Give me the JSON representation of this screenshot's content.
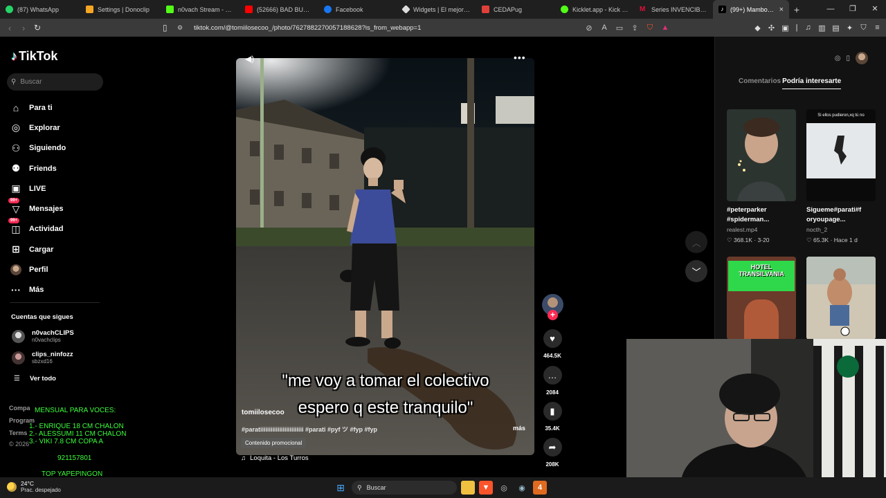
{
  "browser": {
    "tabs": [
      {
        "title": "(87) WhatsApp",
        "color": "#25d366"
      },
      {
        "title": "Settings | Donoclip",
        "color": "#f5a623"
      },
      {
        "title": "n0vach Stream - Watch",
        "color": "#53fc18"
      },
      {
        "title": "(52666) BAD BUNNY -",
        "color": "#ff0000"
      },
      {
        "title": "Facebook",
        "color": "#1877f2"
      },
      {
        "title": "Widgets | El mejor soft",
        "color": "#dddddd"
      },
      {
        "title": "CEDAPug",
        "color": "#e0403a"
      },
      {
        "title": "Kicklet.app - Kick Chat",
        "color": "#53fc18"
      },
      {
        "title": "Series INVENCIBLE (20",
        "color": "#e0103a"
      },
      {
        "title": "(99+) Mambo Mul",
        "color": "#222222",
        "active": true
      }
    ],
    "url": "tiktok.com/@tomiilosecoo_/photo/7627882270057188628?is_from_webapp=1"
  },
  "tiktok": {
    "logo": "TikTok",
    "search_placeholder": "Buscar",
    "nav": [
      {
        "label": "Para ti",
        "icon": "home-icon"
      },
      {
        "label": "Explorar",
        "icon": "compass-icon"
      },
      {
        "label": "Siguiendo",
        "icon": "following-icon"
      },
      {
        "label": "Friends",
        "icon": "friends-icon"
      },
      {
        "label": "LIVE",
        "icon": "live-icon"
      },
      {
        "label": "Mensajes",
        "icon": "messages-icon",
        "badge": "99+"
      },
      {
        "label": "Actividad",
        "icon": "activity-icon",
        "badge": "99+"
      },
      {
        "label": "Cargar",
        "icon": "upload-icon"
      },
      {
        "label": "Perfil",
        "icon": "avatar"
      },
      {
        "label": "Más",
        "icon": "more-icon"
      }
    ],
    "following_title": "Cuentas que sigues",
    "following": [
      {
        "name": "n0vachCLIPS",
        "handle": "n0vachclips"
      },
      {
        "name": "clips_ninfozz",
        "handle": "sbzxd16"
      }
    ],
    "see_all": "Ver todo",
    "footer": [
      "Compa",
      "Program",
      "Terms",
      "© 2026"
    ],
    "post": {
      "caption_line1": "\"me voy a tomar el colectivo",
      "caption_line2": "espero q este tranquilo\"",
      "author": "tomiilosecoo",
      "hashtags": "#paratiiiiiiiiiiiiiiiiiiiiiiiii #parati #pyf ツ #fyp #fyp",
      "more": "más",
      "promo_label": "Contenido promocional",
      "music": "Loquita - Los Turros",
      "likes": "464.5K",
      "comments": "2084",
      "saves": "35.4K",
      "shares": "208K"
    },
    "right_panel": {
      "tabs": [
        "Comentarios",
        "Podría interesarte"
      ],
      "active_tab": "Podría interesarte",
      "cards": [
        {
          "desc1": "#peterparker",
          "desc2": "#spiderman...",
          "who": "realest.mp4",
          "likes": "368.1K",
          "date": "3-20"
        },
        {
          "desc1": "Sigueme#parati#f",
          "desc2": "oryoupage...",
          "who": "nocth_2",
          "likes": "65.3K",
          "date": "Hace 1 d",
          "thumb_text": "Si ellos pudieron,xq tú no"
        },
        {
          "thumb_text": "HOTEL TRANSILVANIA"
        },
        {}
      ]
    }
  },
  "stream_overlay": {
    "title": "MENSUAL PARA VOCES:",
    "lines": [
      "1.- ENRIQUE 18 CM CHALON",
      "2.- ALESSUMI 11 CM CHALON",
      "3.- VIKI 7.8 CM COPA A"
    ],
    "number": "921157801",
    "footer": "TOP YAPEPINGON"
  },
  "taskbar": {
    "temp": "24°C",
    "weather": "Prac. despejado",
    "search": "Buscar"
  }
}
